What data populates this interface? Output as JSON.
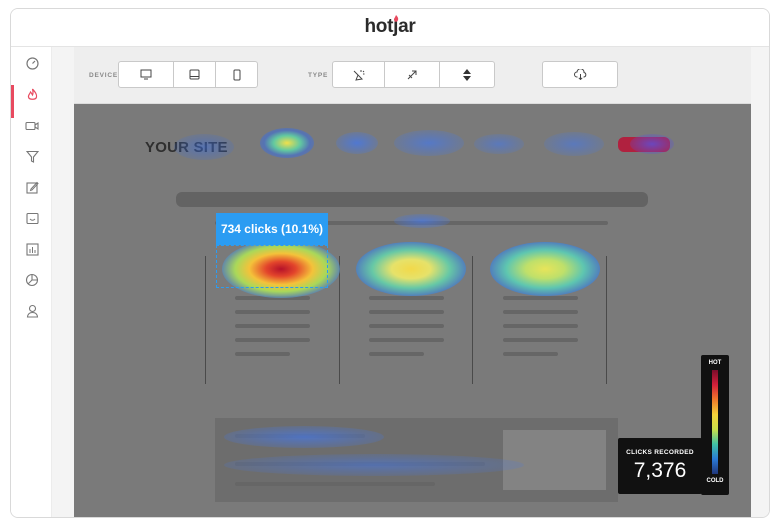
{
  "brand": {
    "logo_text": "hotjar",
    "accent": "#e84a5f"
  },
  "sidebar": {
    "items": [
      {
        "icon": "dashboard-gauge-icon",
        "active": false
      },
      {
        "icon": "heatmap-flame-icon",
        "active": true
      },
      {
        "icon": "recordings-camera-icon",
        "active": false
      },
      {
        "icon": "funnel-icon",
        "active": false
      },
      {
        "icon": "forms-edit-icon",
        "active": false
      },
      {
        "icon": "feedback-smile-icon",
        "active": false
      },
      {
        "icon": "polls-bar-chart-icon",
        "active": false
      },
      {
        "icon": "surveys-pie-chart-icon",
        "active": false
      },
      {
        "icon": "recruiters-user-icon",
        "active": false
      }
    ]
  },
  "toolbar": {
    "device_label": "DEVICE",
    "device_options": [
      "desktop-icon",
      "tablet-icon",
      "mobile-icon"
    ],
    "type_label": "TYPE",
    "type_options": [
      "click-icon",
      "move-icon",
      "scroll-icon"
    ],
    "download_icon": "download-cloud-icon"
  },
  "preview": {
    "site_title": "YOUR SITE",
    "tooltip": "734 clicks (10.1%)"
  },
  "stats": {
    "clicks_label": "CLICKS RECORDED",
    "clicks_value": "7,376"
  },
  "legend": {
    "hot": "HOT",
    "cold": "COLD"
  }
}
